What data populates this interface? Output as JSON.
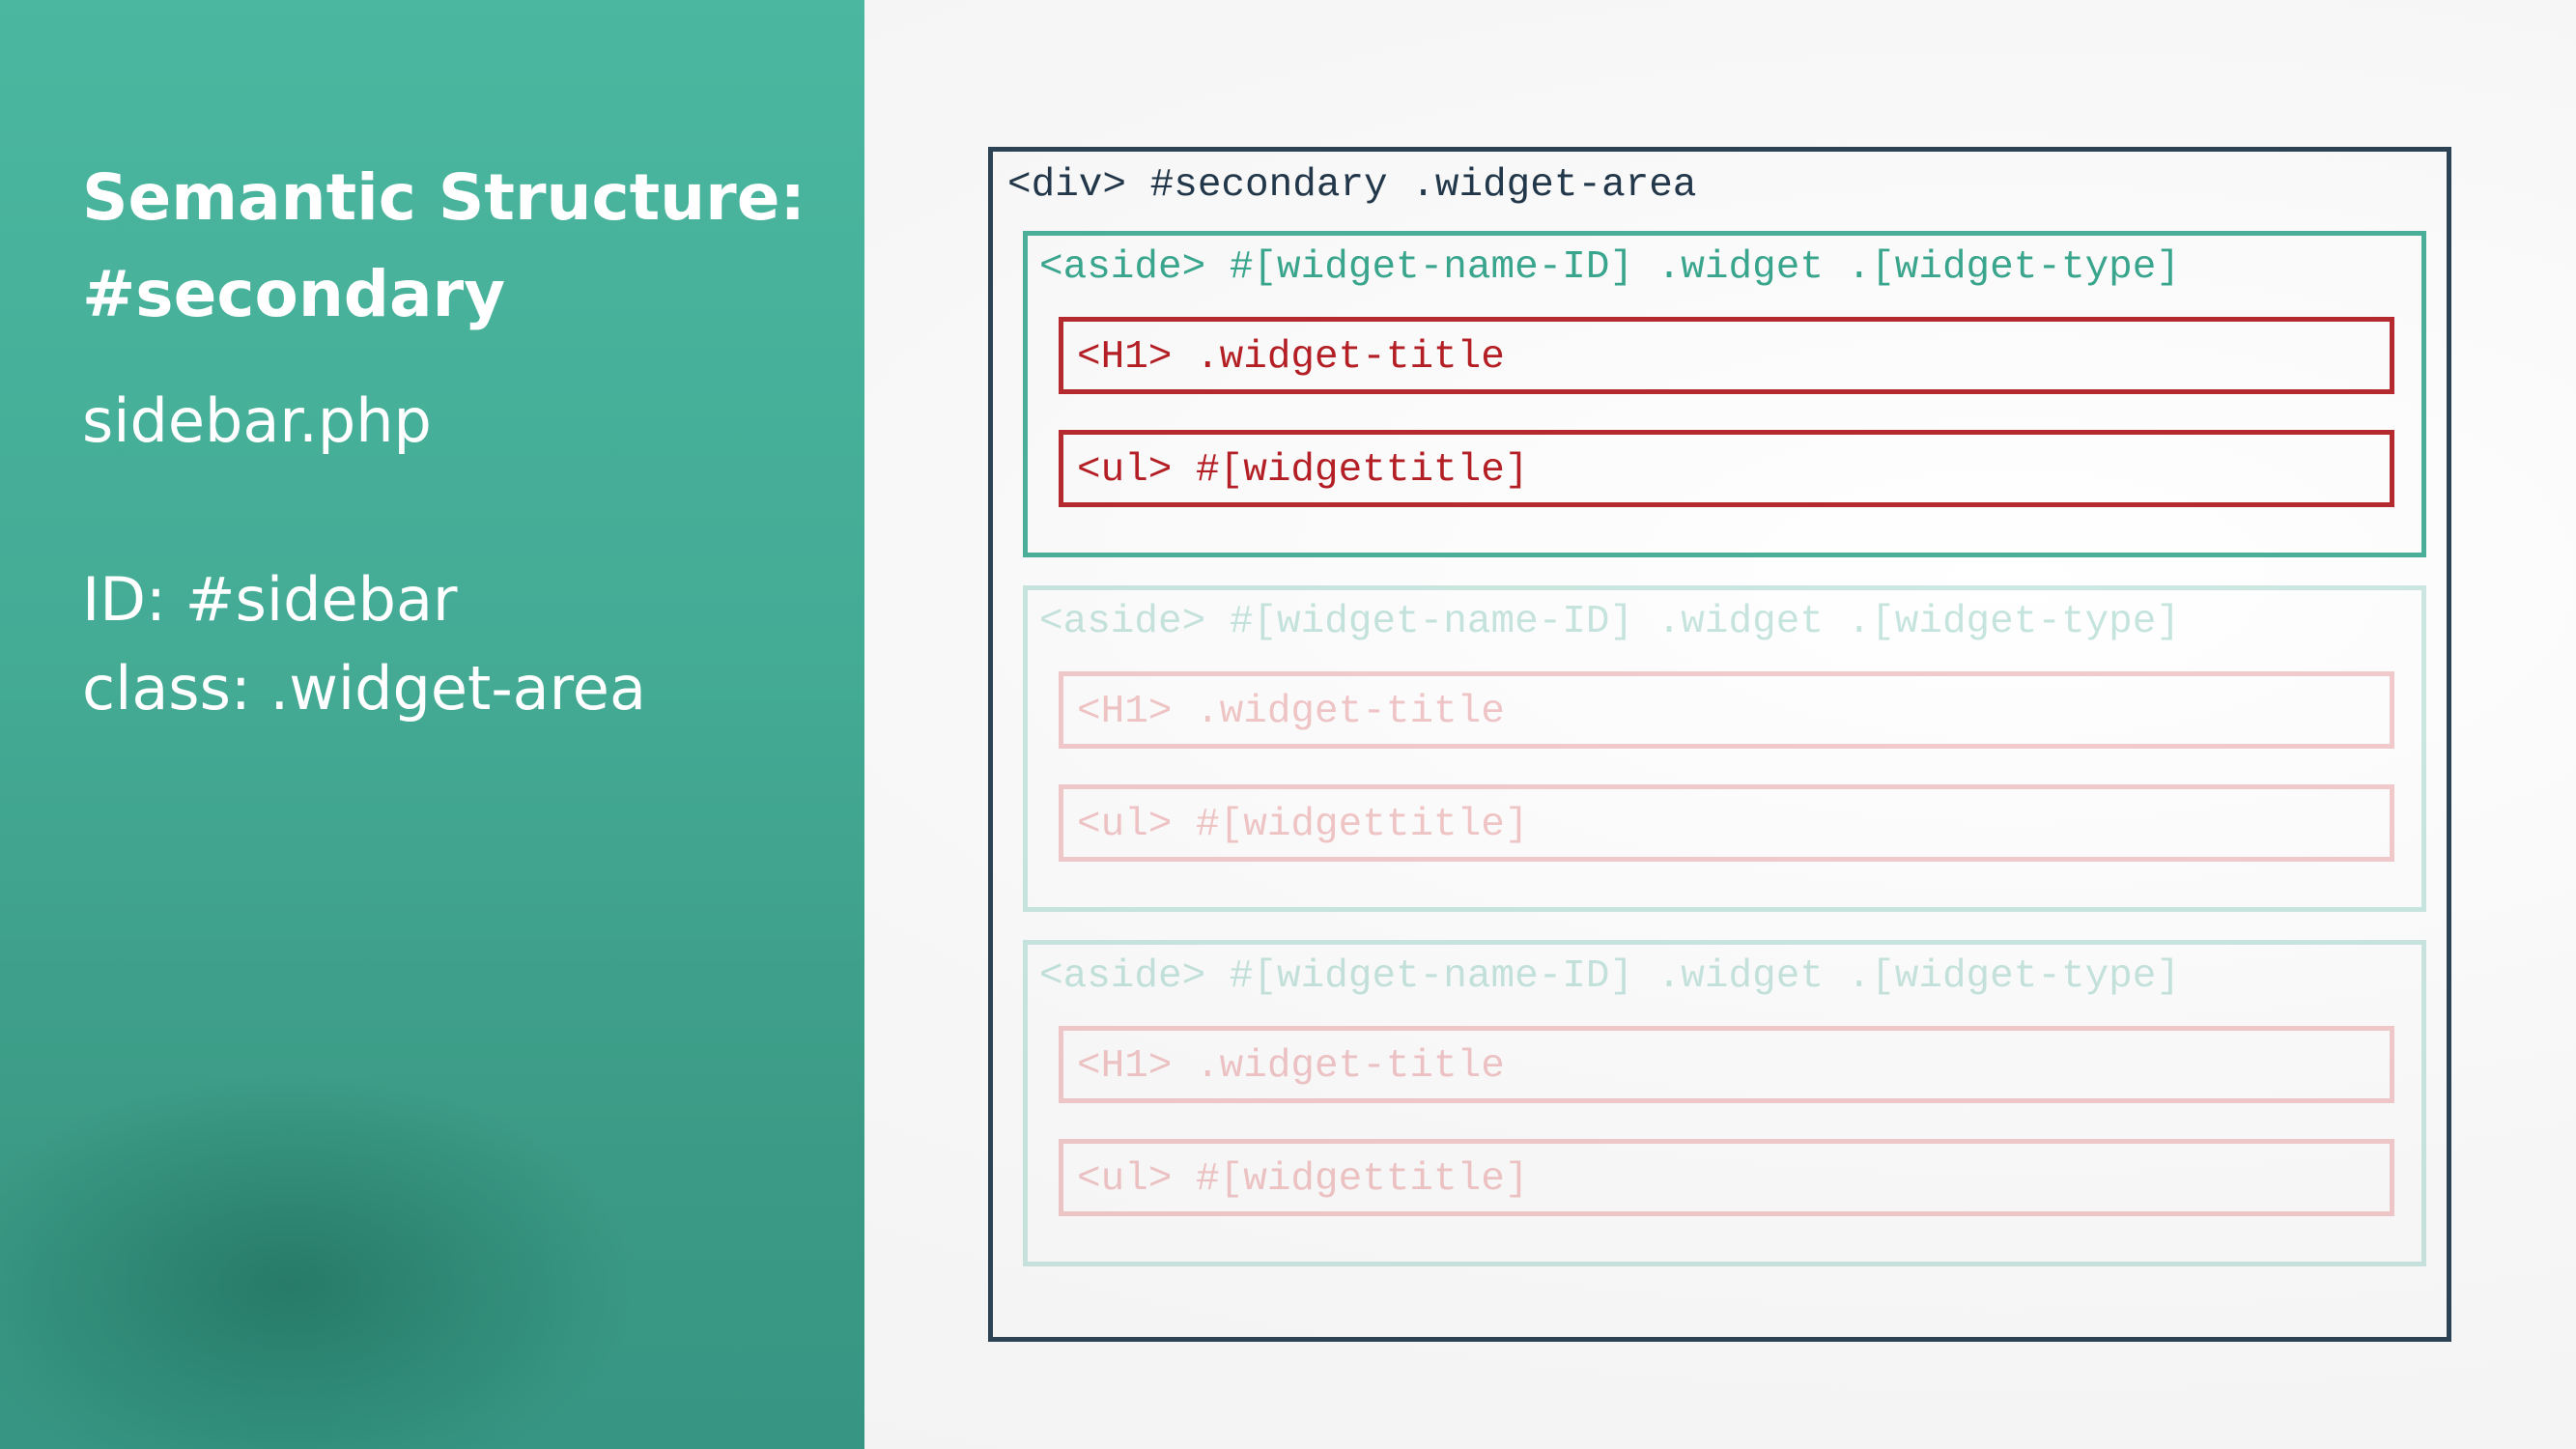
{
  "slide": {
    "title_line1": "Semantic Structure:",
    "title_line2": "#secondary",
    "file": "sidebar.php",
    "id_line": "ID: #sidebar",
    "class_line": "class: .widget-area"
  },
  "diagram": {
    "container_label": "<div> #secondary .widget-area",
    "asides": [
      {
        "label": "<aside> #[widget-name-ID] .widget .[widget-type]",
        "title_label": "<H1> .widget-title",
        "list_label": "<ul> #[widgettitle]",
        "state": "active"
      },
      {
        "label": "<aside> #[widget-name-ID] .widget .[widget-type]",
        "title_label": "<H1> .widget-title",
        "list_label": "<ul> #[widgettitle]",
        "state": "faded"
      },
      {
        "label": "<aside> #[widget-name-ID] .widget .[widget-type]",
        "title_label": "<H1> .widget-title",
        "list_label": "<ul> #[widgettitle]",
        "state": "faded"
      }
    ]
  },
  "colors": {
    "panel": "#46ae98",
    "container_border": "#2b4355",
    "aside_border": "#4aae98",
    "element_border": "#b52a2f"
  }
}
